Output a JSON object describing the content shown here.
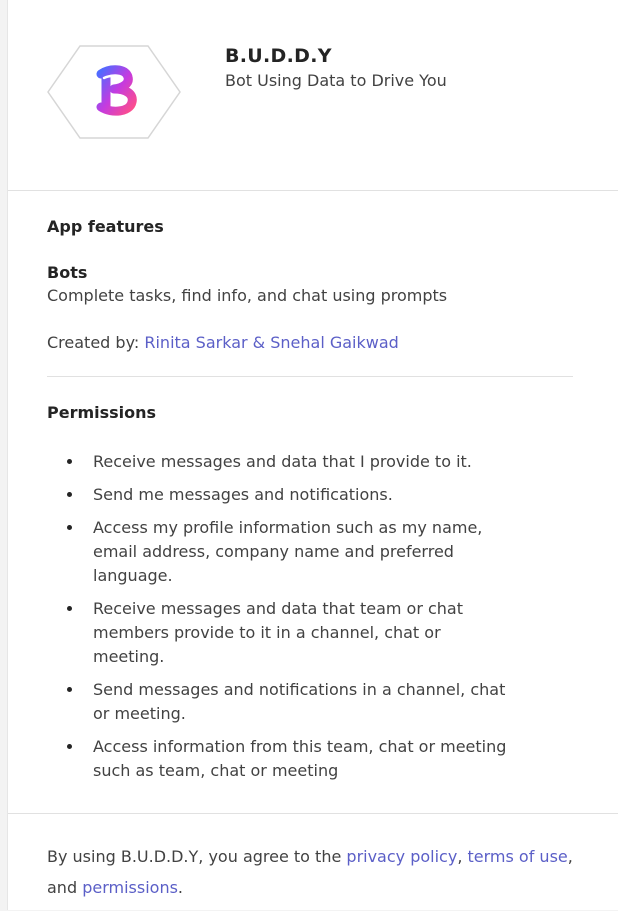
{
  "app": {
    "name": "B.U.D.D.Y",
    "tagline": "Bot Using Data to Drive You",
    "logo_icon": "buddy-b-logo",
    "logo_colors": [
      "#4f6bff",
      "#c43be0",
      "#ff4e8a"
    ]
  },
  "features": {
    "heading": "App features",
    "bots_title": "Bots",
    "bots_description": "Complete tasks, find info, and chat using prompts",
    "created_by_label": "Created by:",
    "created_by_names": "Rinita Sarkar & Snehal Gaikwad"
  },
  "permissions": {
    "heading": "Permissions",
    "items": [
      "Receive messages and data that I provide to it.",
      "Send me messages and notifications.",
      "Access my profile information such as my name, email address, company name and preferred language.",
      "Receive messages and data that team or chat members provide to it in a channel, chat or meeting.",
      "Send messages and notifications in a channel, chat or meeting.",
      "Access information from this team, chat or meeting such as team, chat or meeting"
    ]
  },
  "footer": {
    "prefix": "By using B.U.D.D.Y, you agree to the",
    "privacy_link": "privacy policy",
    "comma": ",",
    "terms_link": "terms of use",
    "middle": ", and",
    "permissions_link": "permissions",
    "suffix": "."
  },
  "colors": {
    "link": "#5b5fc7",
    "text": "#424242",
    "heading": "#242424"
  }
}
